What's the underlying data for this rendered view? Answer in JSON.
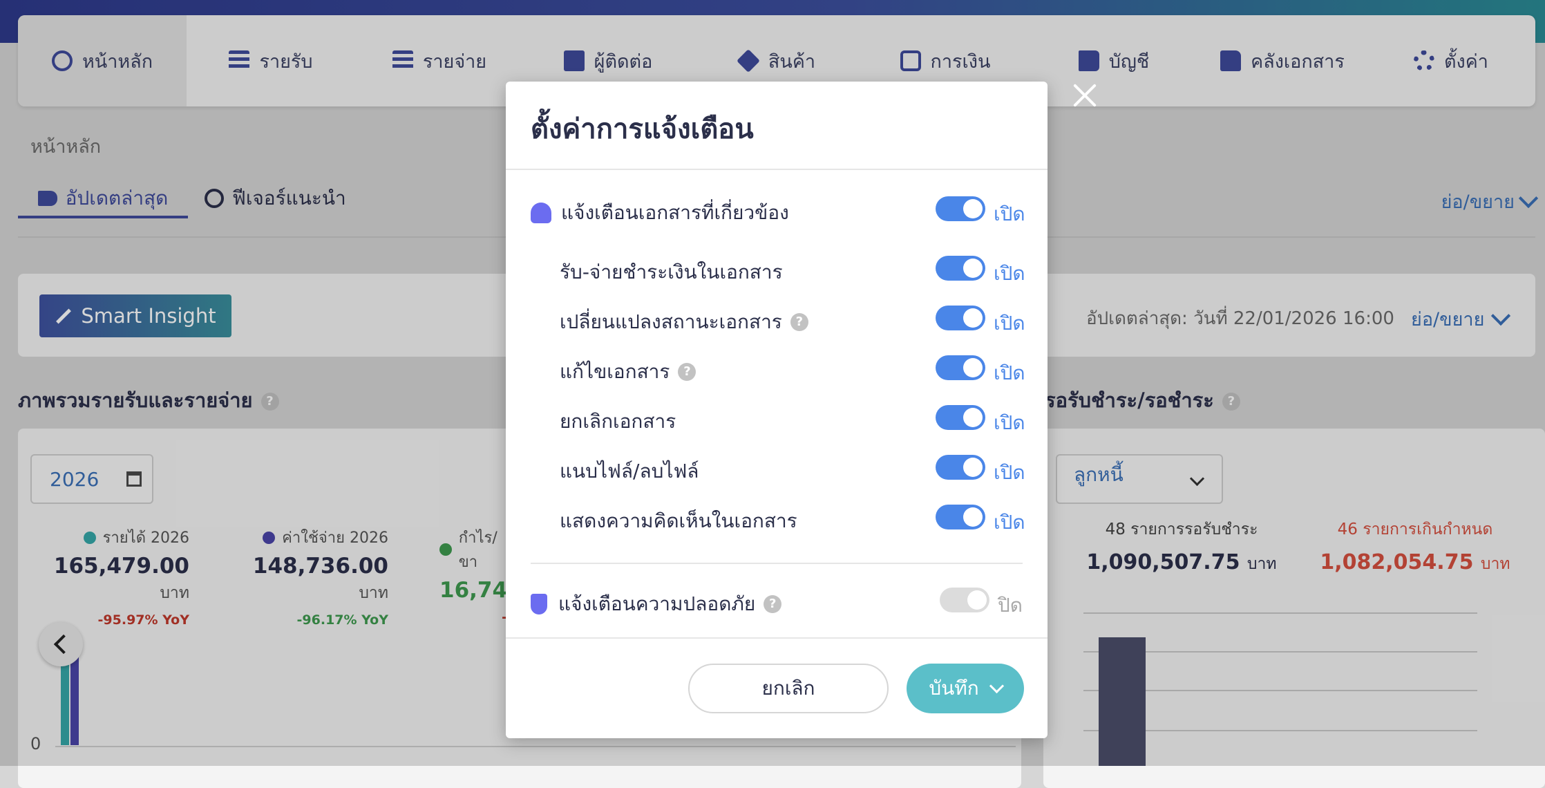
{
  "nav": {
    "items": [
      {
        "label": "หน้าหลัก",
        "icon": "dashboard-icon"
      },
      {
        "label": "รายรับ",
        "icon": "income-icon"
      },
      {
        "label": "รายจ่าย",
        "icon": "expense-icon"
      },
      {
        "label": "ผู้ติดต่อ",
        "icon": "contacts-icon"
      },
      {
        "label": "สินค้า",
        "icon": "product-box-icon"
      },
      {
        "label": "การเงิน",
        "icon": "money-icon"
      },
      {
        "label": "บัญชี",
        "icon": "ledger-book-icon"
      },
      {
        "label": "คลังเอกสาร",
        "icon": "folder-icon"
      },
      {
        "label": "ตั้งค่า",
        "icon": "gear-icon"
      }
    ]
  },
  "breadcrumb": "หน้าหลัก",
  "tabs": {
    "latest": "อัปเดตล่าสุด",
    "features": "ฟีเจอร์แนะนำ",
    "collapse": "ย่อ/ขยาย"
  },
  "insight": {
    "button": "Smart Insight",
    "updated": "อัปเดตล่าสุด: วันที่ 22/01/2026 16:00",
    "collapse": "ย่อ/ขยาย"
  },
  "overview": {
    "title": "ภาพรวมรายรับและรายจ่าย",
    "help": "?",
    "year": "2026",
    "stats": [
      {
        "label": "รายได้ 2026",
        "value": "165,479.00",
        "unit": "บาท",
        "yoy": "-95.97% YoY",
        "color": "#35a7a9",
        "yoy_color": "#c0392b"
      },
      {
        "label": "ค่าใช้จ่าย 2026",
        "value": "148,736.00",
        "unit": "บาท",
        "yoy": "-96.17% YoY",
        "color": "#4a45a8",
        "yoy_color": "#3f9a4f"
      },
      {
        "label": "กำไร/ขา",
        "value": "16,74",
        "unit": "",
        "yoy": "-",
        "color": "#3f9a4f",
        "yoy_color": "#c0392b"
      }
    ],
    "axis_zero": "0"
  },
  "receivables": {
    "title": "รอรับชำระ/รอชำระ",
    "help": "?",
    "select": "ลูกหนี้",
    "pending_label": "48 รายการรอรับชำระ",
    "pending_value": "1,090,507.75",
    "overdue_label": "46 รายการเกินกำหนด",
    "overdue_value": "1,082,054.75",
    "unit": "บาท"
  },
  "modal": {
    "title": "ตั้งค่าการแจ้งเตือน",
    "rows": [
      {
        "label": "แจ้งเตือนเอกสารที่เกี่ยวข้อง",
        "state": "เปิด",
        "on": true
      },
      {
        "label": "รับ-จ่ายชำระเงินในเอกสาร",
        "state": "เปิด",
        "on": true
      },
      {
        "label": "เปลี่ยนแปลงสถานะเอกสาร",
        "state": "เปิด",
        "on": true
      },
      {
        "label": "แก้ไขเอกสาร",
        "state": "เปิด",
        "on": true
      },
      {
        "label": "ยกเลิกเอกสาร",
        "state": "เปิด",
        "on": true
      },
      {
        "label": "แนบไฟล์/ลบไฟล์",
        "state": "เปิด",
        "on": true
      },
      {
        "label": "แสดงความคิดเห็นในเอกสาร",
        "state": "เปิด",
        "on": true
      },
      {
        "label": "แจ้งเตือนความปลอดภัย",
        "state": "ปิด",
        "on": false
      }
    ],
    "cancel": "ยกเลิก",
    "save": "บันทึก",
    "help": "?"
  },
  "colors": {
    "accent": "#4a86e8",
    "save": "#5bbfc9",
    "toggle_off": "#dcdcdc"
  }
}
